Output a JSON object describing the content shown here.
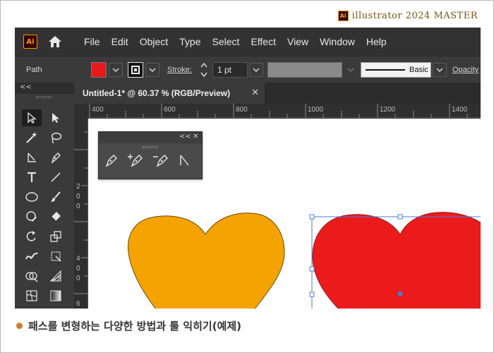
{
  "brand": {
    "logo": "Ai",
    "title": "illustrator 2024 MASTER"
  },
  "app": {
    "logo": "Ai",
    "menu": [
      "File",
      "Edit",
      "Object",
      "Type",
      "Select",
      "Effect",
      "View",
      "Window",
      "Help"
    ],
    "control": {
      "selection_label": "Path",
      "fill_color": "#e8191c",
      "stroke_label": "Stroke:",
      "stroke_value": "1 pt",
      "profile_label": "Basic",
      "opacity_label": "Opacity"
    },
    "document_tab": {
      "title": "Untitled-1* @ 60.37 % (RGB/Preview)"
    },
    "toolbox_collapse": "<<",
    "ruler_h": [
      "400",
      "600",
      "800",
      "1000",
      "1200",
      "1400"
    ],
    "ruler_v": [
      "2",
      "0",
      "0",
      "4",
      "0",
      "0",
      "6"
    ],
    "floating_panel": {
      "collapse": "<<",
      "close": "✕"
    },
    "colors": {
      "orange_heart": "#f5a300",
      "red_heart": "#ec1b1b",
      "selection": "#4a7bd8"
    }
  },
  "caption": {
    "text": "패스를 변형하는 다양한 방법과 툴 익히기(예제)"
  }
}
